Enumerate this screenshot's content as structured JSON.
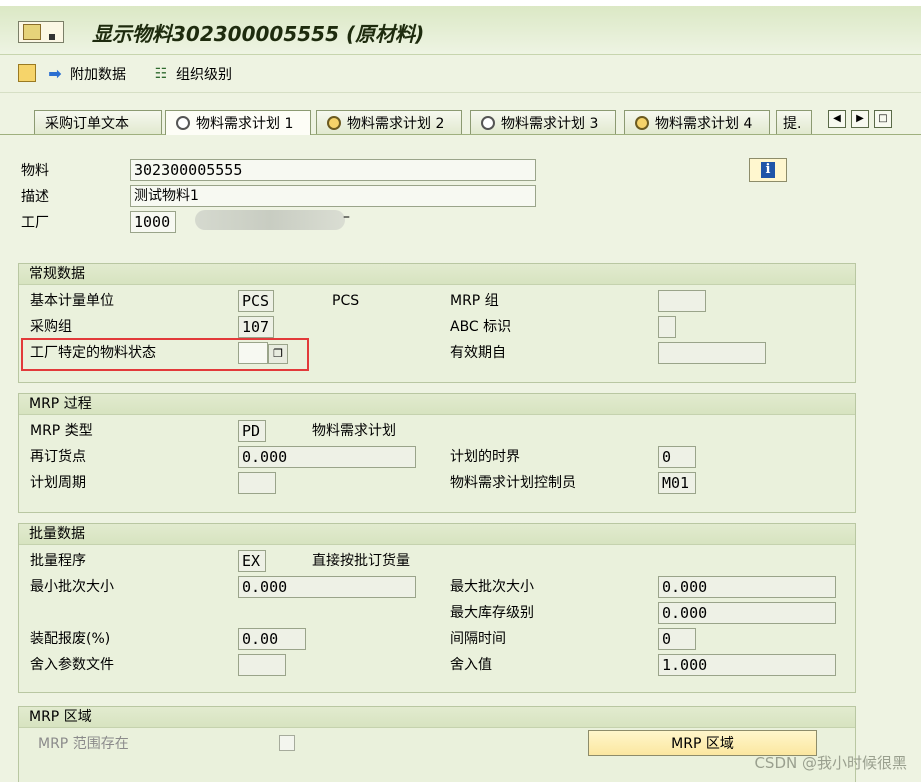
{
  "window": {
    "title": "显示物料302300005555 (原材料)"
  },
  "toolbar": {
    "items": [
      {
        "label": ""
      },
      {
        "label": "附加数据"
      },
      {
        "label": "组织级别"
      }
    ]
  },
  "tabs": [
    {
      "label": "采购订单文本"
    },
    {
      "label": "物料需求计划 1",
      "active": true
    },
    {
      "label": "物料需求计划 2"
    },
    {
      "label": "物料需求计划 3"
    },
    {
      "label": "物料需求计划 4"
    },
    {
      "label": "提."
    }
  ],
  "header": {
    "material_label": "物料",
    "material_value": "302300005555",
    "desc_label": "描述",
    "desc_value": "测试物料1",
    "plant_label": "工厂",
    "plant_value": "1000",
    "plant_name_suffix": "–"
  },
  "general": {
    "title": "常规数据",
    "base_uom_label": "基本计量单位",
    "base_uom_value": "PCS",
    "base_uom_text": "PCS",
    "purch_group_label": "采购组",
    "purch_group_value": "107",
    "plant_status_label": "工厂特定的物料状态",
    "plant_status_value": "",
    "mrp_group_label": "MRP 组",
    "mrp_group_value": "",
    "abc_label": "ABC 标识",
    "abc_value": "",
    "valid_from_label": "有效期自",
    "valid_from_value": ""
  },
  "mrp_proc": {
    "title": "MRP 过程",
    "mrp_type_label": "MRP 类型",
    "mrp_type_value": "PD",
    "mrp_type_text": "物料需求计划",
    "reorder_label": "再订货点",
    "reorder_value": "0.000",
    "cycle_label": "计划周期",
    "cycle_value": "",
    "time_fence_label": "计划的时界",
    "time_fence_value": "0",
    "controller_label": "物料需求计划控制员",
    "controller_value": "M01"
  },
  "lot": {
    "title": "批量数据",
    "proc_label": "批量程序",
    "proc_value": "EX",
    "proc_text": "直接按批订货量",
    "min_label": "最小批次大小",
    "min_value": "0.000",
    "max_label": "最大批次大小",
    "max_value": "0.000",
    "maxstock_label": "最大库存级别",
    "maxstock_value": "0.000",
    "scrap_label": "装配报废(%)",
    "scrap_value": "0.00",
    "interval_label": "间隔时间",
    "interval_value": "0",
    "rounding_profile_label": "舍入参数文件",
    "rounding_profile_value": "",
    "rounding_value_label": "舍入值",
    "rounding_value_value": "1.000"
  },
  "mrp_area": {
    "title": "MRP 区域",
    "exists_label": "MRP  范围存在",
    "button_label": "MRP 区域"
  },
  "watermark": "CSDN @我小时候很黑"
}
